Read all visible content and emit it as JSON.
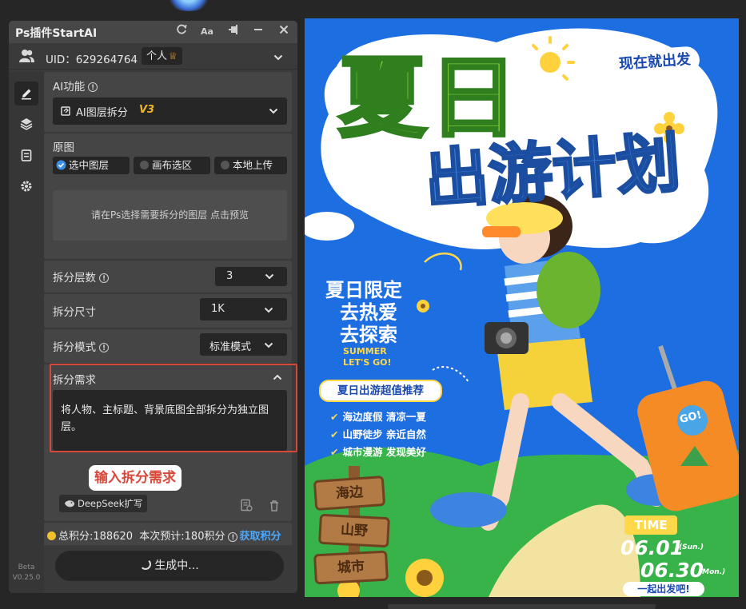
{
  "panel": {
    "title": "Ps插件StartAI",
    "titlebar_icons": [
      "refresh-icon",
      "font-size-icon",
      "pin-icon",
      "minimize-icon",
      "close-icon"
    ],
    "user": {
      "uid": "UID：629264764",
      "badge": "个人"
    },
    "sidebar": {
      "items": [
        "edit-icon",
        "layers-icon",
        "clipboard-icon",
        "settings-icon"
      ],
      "beta": "Beta",
      "version": "V0.25.0"
    },
    "ai_function": {
      "label": "AI功能",
      "selected": "AI图层拆分",
      "version_tag": "V3"
    },
    "source_image": {
      "label": "原图",
      "options": [
        "选中图层",
        "画布选区",
        "本地上传"
      ],
      "selected_index": 0,
      "placeholder": "请在Ps选择需要拆分的图层 点击预览"
    },
    "layer_count": {
      "label": "拆分层数",
      "value": "3"
    },
    "size": {
      "label": "拆分尺寸",
      "value": "1K"
    },
    "mode": {
      "label": "拆分模式",
      "value": "标准模式"
    },
    "requirement": {
      "label": "拆分需求",
      "text": "将人物、主标题、背景底图全部拆分为独立图层。",
      "callout": "输入拆分需求",
      "deepseek_label": "DeepSeek扩写"
    },
    "footer": {
      "total_points": "总积分:188620",
      "estimate": "本次预计:180积分",
      "get_points": "获取积分",
      "generate": "生成中..."
    }
  },
  "poster": {
    "tag": "现在就出发",
    "title_line1": "夏日",
    "title_line2": "出游计划",
    "subtitle_lines": [
      "夏日限定",
      "去热爱",
      "去探索"
    ],
    "english": [
      "SUMMER",
      "LET'S GO!"
    ],
    "recommend": "夏日出游超值推荐",
    "checks": [
      "海边度假 清凉一夏",
      "山野徒步 亲近自然",
      "城市漫游 发现美好"
    ],
    "signs": [
      "海边",
      "山野",
      "城市"
    ],
    "luggage_sticker": "GO!",
    "time": {
      "label": "TIME",
      "date1": "06.01",
      "day1": "(Sun.)",
      "date2": "06.30",
      "day2": "(Mon.)",
      "slogan": "一起出发吧!"
    }
  }
}
